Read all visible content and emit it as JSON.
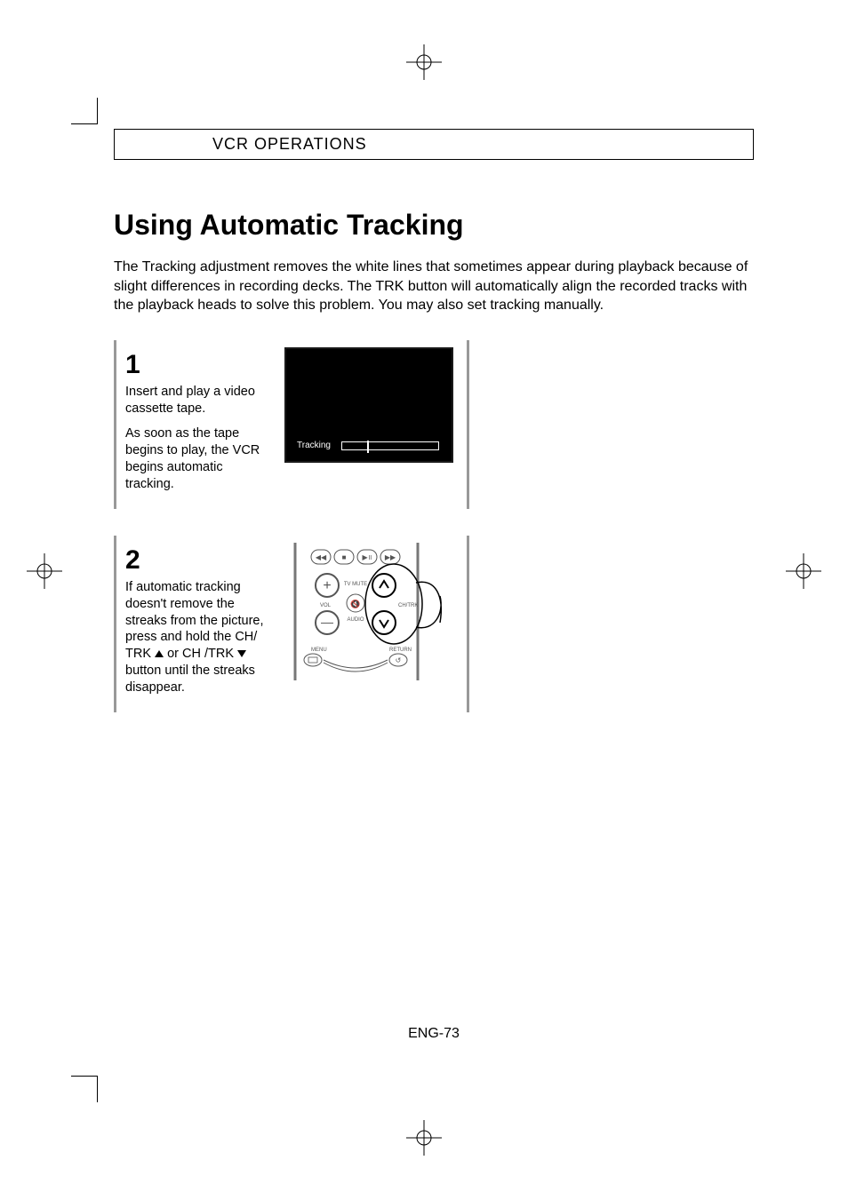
{
  "header": {
    "section": "VCR OPERATIONS"
  },
  "title": "Using Automatic Tracking",
  "intro": "The Tracking adjustment removes the white lines that sometimes appear during playback because of slight differences in recording decks. The TRK button will automatically align the recorded tracks with the playback heads to solve this problem. You may also set tracking manually.",
  "steps": [
    {
      "num": "1",
      "para1": "Insert and play a video cassette tape.",
      "para2": "As soon as the tape begins to play, the VCR begins automatic tracking.",
      "screen_label": "Tracking"
    },
    {
      "num": "2",
      "para_before": "If automatic tracking doesn't remove the streaks from the picture, press and hold the CH/ TRK ",
      "para_mid": " or CH /TRK ",
      "para_after": " button until the streaks disappear.",
      "remote_labels": {
        "tv_mute": "TV MUTE",
        "vol": "VOL",
        "ch_trk": "CH/TRK",
        "audio": "AUDIO",
        "menu": "MENU",
        "return": "RETURN"
      }
    }
  ],
  "page_number": "ENG-73"
}
